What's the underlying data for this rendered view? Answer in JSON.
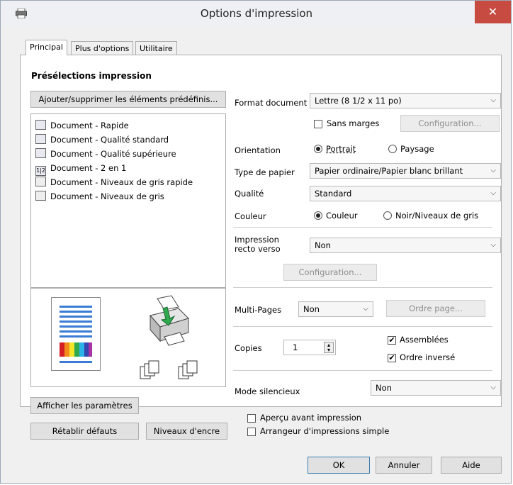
{
  "window": {
    "title": "Options d'impression",
    "close_glyph": "✕",
    "app_icon": "printer-icon"
  },
  "tabs": [
    {
      "label": "Principal",
      "active": true
    },
    {
      "label": "Plus d'options",
      "active": false
    },
    {
      "label": "Utilitaire",
      "active": false
    }
  ],
  "presets": {
    "heading": "Présélections impression",
    "manage_button": "Ajouter/supprimer les éléments prédéfinis...",
    "items": [
      {
        "label": "Document - Rapide",
        "icon": "document-icon"
      },
      {
        "label": "Document - Qualité standard",
        "icon": "document-icon"
      },
      {
        "label": "Document - Qualité supérieure",
        "icon": "document-icon"
      },
      {
        "label": "Document - 2 en 1",
        "icon": "two-up-icon",
        "glyph": "1|2"
      },
      {
        "label": "Document - Niveaux de gris rapide",
        "icon": "grayscale-document-icon"
      },
      {
        "label": "Document - Niveaux de gris",
        "icon": "grayscale-document-icon"
      }
    ]
  },
  "settings": {
    "format_label": "Format document",
    "format_value": "Lettre (8 1/2 x 11 po)",
    "borderless_label": "Sans marges",
    "borderless_checked": false,
    "config_button": "Configuration...",
    "orientation_label": "Orientation",
    "portrait_label": "Portrait",
    "landscape_label": "Paysage",
    "orientation_value": "Portrait",
    "paper_type_label": "Type de papier",
    "paper_type_value": "Papier ordinaire/Papier blanc brillant",
    "quality_label": "Qualité",
    "quality_value": "Standard",
    "color_label": "Couleur",
    "color_option_color": "Couleur",
    "color_option_gray": "Noir/Niveaux de gris",
    "color_value": "Couleur",
    "duplex_label_1": "Impression",
    "duplex_label_2": "recto verso",
    "duplex_value": "Non",
    "duplex_config_button": "Configuration...",
    "multipage_label": "Multi-Pages",
    "multipage_value": "Non",
    "page_order_button": "Ordre page...",
    "copies_label": "Copies",
    "copies_value": "1",
    "collate_label": "Assemblées",
    "collate_checked": true,
    "reverse_label": "Ordre inversé",
    "reverse_checked": true,
    "quiet_label": "Mode silencieux",
    "quiet_value": "Non",
    "preview_label": "Aperçu avant impression",
    "preview_checked": false,
    "arranger_label": "Arrangeur d'impressions simple",
    "arranger_checked": false
  },
  "bottom_left": {
    "show_settings_button": "Afficher les paramètres",
    "restore_defaults_button": "Rétablir défauts",
    "ink_levels_button": "Niveaux d'encre"
  },
  "dialog_buttons": {
    "ok": "OK",
    "cancel": "Annuler",
    "help": "Aide"
  },
  "icons": {
    "dropdown_arrow": "⌵",
    "spin_up": "▴",
    "spin_down": "▾",
    "check": "✔"
  },
  "colors": {
    "close_button": "#c74b41",
    "paper_lines": "#3a7bd5",
    "arrow_green": "#2fa84f"
  }
}
